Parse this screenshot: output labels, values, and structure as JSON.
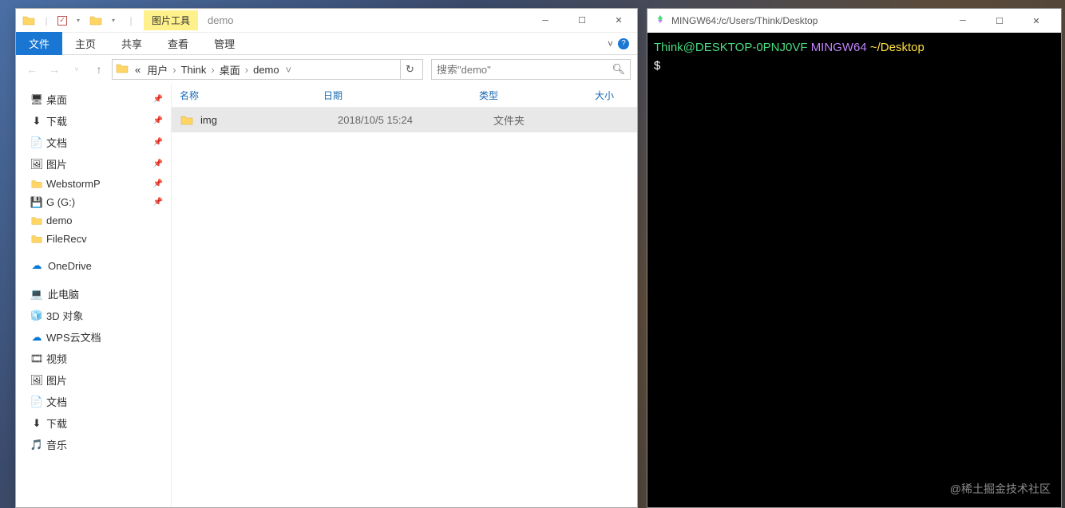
{
  "explorer": {
    "toolsTab": "图片工具",
    "title": "demo",
    "ribbon": {
      "file": "文件",
      "home": "主页",
      "share": "共享",
      "view": "查看",
      "manage": "管理"
    },
    "breadcrumb": {
      "prefix": "«",
      "users": "用户",
      "user": "Think",
      "desktop": "桌面",
      "folder": "demo"
    },
    "searchPlaceholder": "搜索\"demo\"",
    "sidebar": {
      "desktop": "桌面",
      "downloads": "下载",
      "documents": "文档",
      "pictures": "图片",
      "webstorm": "WebstormP",
      "gdrive": "G (G:)",
      "demo": "demo",
      "filerecv": "FileRecv",
      "onedrive": "OneDrive",
      "thispc": "此电脑",
      "objects3d": "3D 对象",
      "wpscloud": "WPS云文档",
      "videos": "视频",
      "pictures2": "图片",
      "documents2": "文档",
      "downloads2": "下载",
      "music": "音乐"
    },
    "columns": {
      "name": "名称",
      "date": "日期",
      "type": "类型",
      "size": "大小"
    },
    "rows": [
      {
        "name": "img",
        "date": "2018/10/5 15:24",
        "type": "文件夹"
      }
    ]
  },
  "terminal": {
    "title": "MINGW64:/c/Users/Think/Desktop",
    "prompt": {
      "user": "Think@DESKTOP-0PNJ0VF",
      "env": "MINGW64",
      "path": "~/Desktop",
      "symbol": "$"
    }
  },
  "watermark": "@稀土掘金技术社区"
}
